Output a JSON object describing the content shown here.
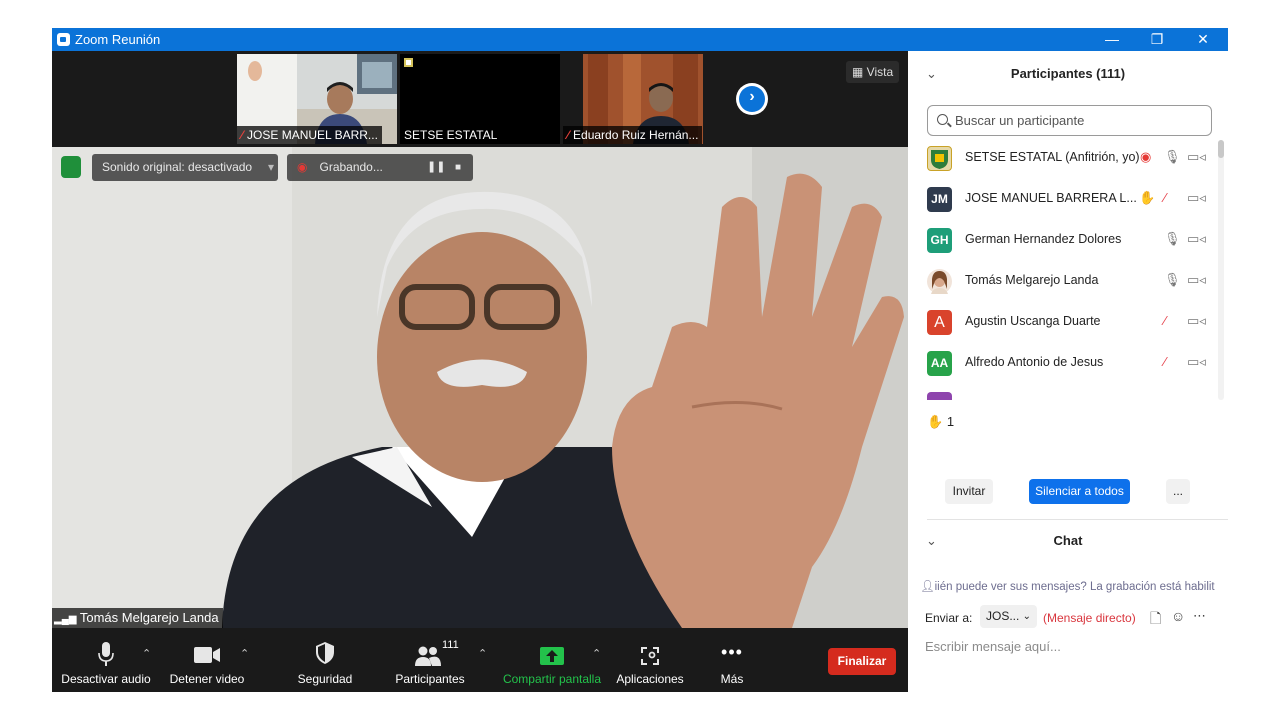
{
  "window": {
    "title": "Zoom Reunión",
    "minimize": "—",
    "maximize": "❐",
    "close": "✕"
  },
  "thumbnails": [
    {
      "name": "JOSE MANUEL BARR...",
      "muted": true
    },
    {
      "name": "SETSE ESTATAL",
      "muted": false
    },
    {
      "name": "Eduardo Ruiz Hernán...",
      "muted": true
    }
  ],
  "view_button": "Vista",
  "top_overlay": {
    "original_sound": "Sonido original: desactivado",
    "recording": "Grabando..."
  },
  "active_speaker": "Tomás Melgarejo Landa",
  "toolbar": {
    "mute": "Desactivar audio",
    "video": "Detener video",
    "security": "Seguridad",
    "participants": "Participantes",
    "participants_count": "111",
    "share": "Compartir pantalla",
    "apps": "Aplicaciones",
    "more": "Más",
    "end": "Finalizar"
  },
  "participants_panel": {
    "title": "Participantes (111)",
    "search_placeholder": "Buscar un participante",
    "list": [
      {
        "name": "SETSE ESTATAL (Anfitrión, yo)",
        "avatar": "",
        "avatar_color": "#c9a227",
        "mic": "on",
        "hand": false,
        "recording": true
      },
      {
        "name": "JOSE MANUEL BARRERA L...",
        "avatar": "JM",
        "avatar_color": "#2f3b4e",
        "mic": "muted",
        "hand": true,
        "recording": false
      },
      {
        "name": "German Hernandez Dolores",
        "avatar": "GH",
        "avatar_color": "#1e9e79",
        "mic": "on",
        "hand": false,
        "recording": false
      },
      {
        "name": "Tomás Melgarejo Landa",
        "avatar": "",
        "avatar_color": "#d8a88c",
        "mic": "on",
        "hand": false,
        "recording": false
      },
      {
        "name": "Agustin Uscanga Duarte",
        "avatar": "A",
        "avatar_color": "#d9432c",
        "mic": "muted",
        "hand": false,
        "recording": false
      },
      {
        "name": "Alfredo Antonio de Jesus",
        "avatar": "AA",
        "avatar_color": "#27a34a",
        "mic": "muted",
        "hand": false,
        "recording": false
      }
    ],
    "raised_hands": "1",
    "invite": "Invitar",
    "mute_all": "Silenciar a todos",
    "more": "..."
  },
  "chat_panel": {
    "title": "Chat",
    "info": "iién puede ver sus mensajes? La grabación está habilit",
    "send_to_label": "Enviar a:",
    "send_to_value": "JOS...",
    "direct_message": "(Mensaje directo)",
    "input_placeholder": "Escribir mensaje aquí..."
  }
}
